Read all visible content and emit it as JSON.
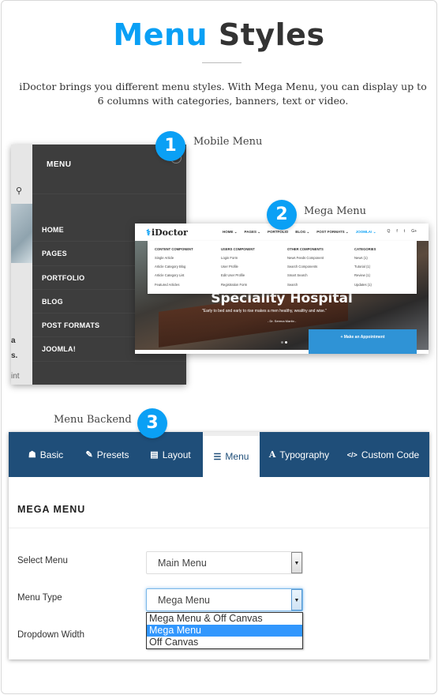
{
  "header": {
    "title_accent": "Menu",
    "title_rest": "Styles",
    "intro": "iDoctor brings you different menu styles. With Mega Menu, you can display up to 6 columns with categories, banners, text or video."
  },
  "colors": {
    "accent": "#0aa0f5",
    "backend_tab_bar": "#1f4e79",
    "selected_option": "#3297fd",
    "mobile_panel": "#3d3d3d"
  },
  "callouts": [
    {
      "number": "1",
      "label": "Mobile Menu"
    },
    {
      "number": "2",
      "label": "Mega Menu"
    },
    {
      "number": "3",
      "label": "Menu Backend"
    }
  ],
  "mobile_menu": {
    "title": "MENU",
    "close_icon": "close-icon",
    "search_icon": "search-icon",
    "items": [
      "HOME",
      "PAGES",
      "PORTFOLIO",
      "BLOG",
      "POST FORMATS",
      "JOOMLA!"
    ],
    "fragments": [
      "a",
      "s.",
      "int"
    ]
  },
  "mega_menu": {
    "logo": "iDoctor",
    "nav": [
      "HOME ⌄",
      "PAGES ⌄",
      "PORTFOLIO",
      "BLOG ⌄",
      "POST FORMATS ⌄",
      "JOOMLA! ⌄"
    ],
    "nav_icons": [
      "Q",
      "f",
      "t",
      "G+"
    ],
    "columns": [
      {
        "heading": "CONTENT COMPONENT",
        "links": [
          "Single Article",
          "Article Category Blog",
          "Article Category List",
          "Featured Articles"
        ]
      },
      {
        "heading": "USERS COMPONENT",
        "links": [
          "Login Form",
          "User Profile",
          "Edit User Profile",
          "Registration Form"
        ]
      },
      {
        "heading": "OTHER COMPONENTS",
        "links": [
          "News Feeds Component",
          "Search Components",
          "Smart Search",
          "Search"
        ]
      },
      {
        "heading": "CATEGORIES",
        "links": [
          "News (1)",
          "Tutorial (1)",
          "Review (1)",
          "Updates (1)"
        ]
      }
    ],
    "hero_title": "Speciality Hospital",
    "hero_quote": "\"Early to bed and early to rise makes a men healthy, wealthy and wise.\"",
    "hero_author": "- Dr. Serena Martin -",
    "appointment_button": "+ Make an Appointment"
  },
  "backend": {
    "tabs": [
      {
        "icon": "☗",
        "icon_name": "home-icon",
        "label": "Basic"
      },
      {
        "icon": "✎",
        "icon_name": "brush-icon",
        "label": "Presets"
      },
      {
        "icon": "▤",
        "icon_name": "layout-icon",
        "label": "Layout"
      },
      {
        "icon": "☰",
        "icon_name": "list-icon",
        "label": "Menu",
        "active": true
      },
      {
        "icon": "A",
        "icon_name": "font-icon",
        "label": "Typography"
      },
      {
        "icon": "</>",
        "icon_name": "code-icon",
        "label": "Custom Code"
      }
    ],
    "section_title": "MEGA MENU",
    "fields": {
      "select_menu": {
        "label": "Select Menu",
        "value": "Main Menu"
      },
      "menu_type": {
        "label": "Menu Type",
        "value": "Mega Menu",
        "options": [
          "Mega Menu & Off Canvas",
          "Mega Menu",
          "Off Canvas"
        ],
        "selected_index": 1
      },
      "dropdown_width": {
        "label": "Dropdown Width"
      }
    }
  }
}
